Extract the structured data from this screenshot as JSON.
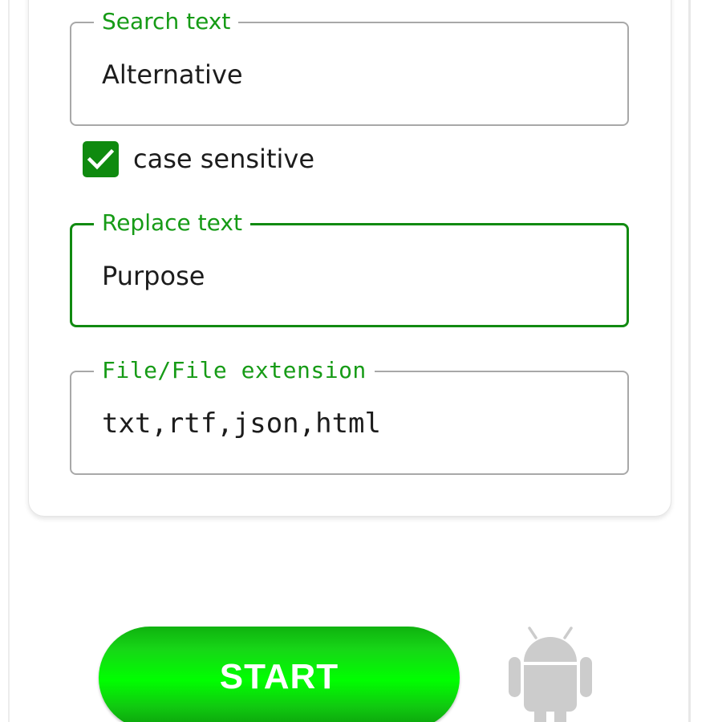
{
  "form": {
    "search": {
      "label": "Search text",
      "value": "Alternative"
    },
    "case_sensitive": {
      "label": "case sensitive",
      "checked": true
    },
    "replace": {
      "label": "Replace text",
      "value": "Purpose"
    },
    "extension": {
      "label": "File/File extension",
      "value": "txt,rtf,json,html"
    }
  },
  "actions": {
    "start_label": "START"
  },
  "icons": {
    "checkbox": "check-icon",
    "mascot": "android-icon"
  },
  "colors": {
    "accent": "#169b16",
    "checkbox": "#0f8a0f",
    "button_green": "#00ff00",
    "android_gray": "#cccccc"
  }
}
